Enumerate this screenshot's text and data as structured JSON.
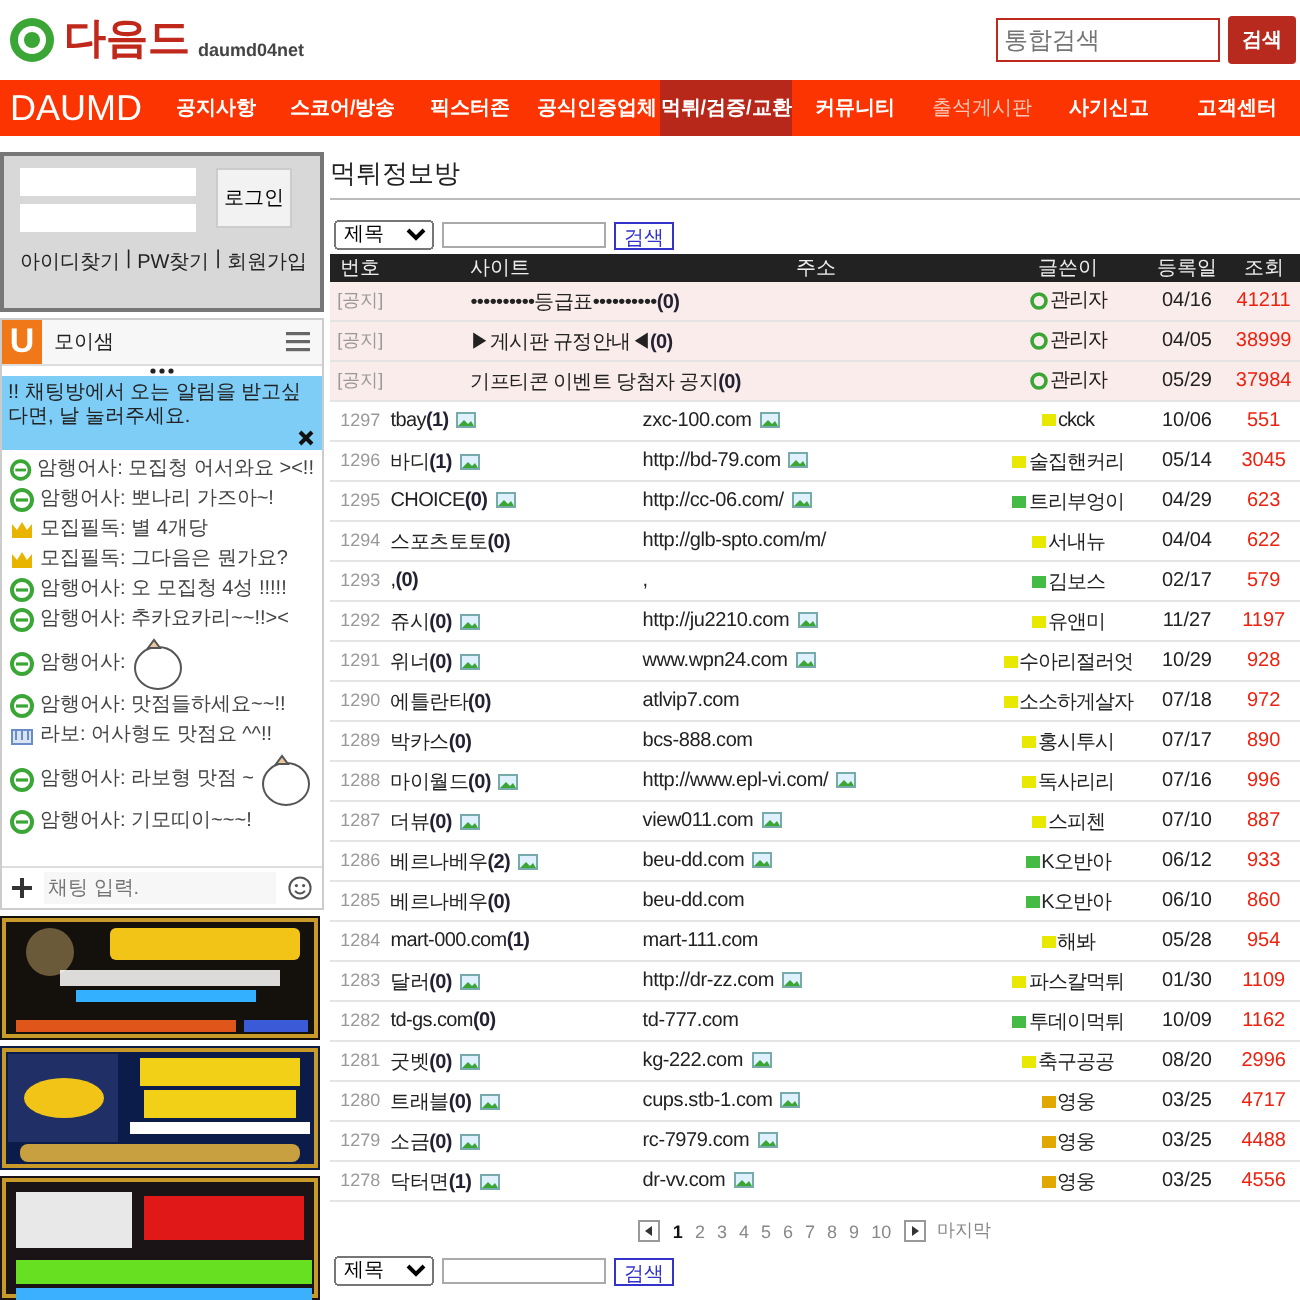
{
  "header": {
    "logo_text": "다음드",
    "logo_sub": "daumd04net",
    "search": {
      "placeholder": "통합검색",
      "button": "검색"
    }
  },
  "nav": {
    "brand": "DAUMD",
    "items": [
      {
        "label": "공지사항",
        "selected": false,
        "muted": false
      },
      {
        "label": "스코어/방송",
        "selected": false,
        "muted": false
      },
      {
        "label": "픽스터존",
        "selected": false,
        "muted": false
      },
      {
        "label": "공식인증업체",
        "selected": false,
        "muted": false
      },
      {
        "label": "먹튀/검증/교환",
        "selected": true,
        "muted": false
      },
      {
        "label": "커뮤니티",
        "selected": false,
        "muted": false
      },
      {
        "label": "출석게시판",
        "selected": false,
        "muted": true
      },
      {
        "label": "사기신고",
        "selected": false,
        "muted": false
      },
      {
        "label": "고객센터",
        "selected": false,
        "muted": false
      }
    ]
  },
  "login": {
    "button": "로그인",
    "links": [
      "아이디찾기",
      "PW찾기",
      "회원가입"
    ],
    "separator": "|"
  },
  "chat": {
    "logo": "U",
    "room": "모이샘",
    "notice": "!! 채팅방에서 오는 알림을 받고싶다면, 날 눌러주세요.",
    "input_placeholder": "채팅 입력.",
    "messages": [
      {
        "kind": "member",
        "text": "암행어사: 모집청 어서와요 ><!!",
        "sticker": false
      },
      {
        "kind": "member",
        "text": "암행어사: 뽀나리 가즈아~!",
        "sticker": false
      },
      {
        "kind": "crown",
        "text": "모집필독: 별 4개당",
        "sticker": false
      },
      {
        "kind": "crown",
        "text": "모집필독: 그다음은 뭔가요?",
        "sticker": false
      },
      {
        "kind": "member",
        "text": "암행어사: 오 모집청 4성 !!!!!",
        "sticker": false
      },
      {
        "kind": "member",
        "text": "암행어사: 추카요카리~~!!><",
        "sticker": false
      },
      {
        "kind": "member",
        "text": "암행어사:",
        "sticker": true
      },
      {
        "kind": "member",
        "text": "암행어사: 맛점들하세요~~!!",
        "sticker": false
      },
      {
        "kind": "guest",
        "text": "라보: 어사형도 맛점요 ^^!!",
        "sticker": false
      },
      {
        "kind": "member",
        "text": "암행어사: 라보형 맛점 ~",
        "sticker": true
      },
      {
        "kind": "member",
        "text": "암행어사: 기모띠이~~~!",
        "sticker": false
      }
    ]
  },
  "board": {
    "title": "먹튀정보방",
    "search": {
      "field": "제목",
      "button": "검색"
    },
    "columns": [
      "번호",
      "사이트",
      "주소",
      "글쓴이",
      "등록일",
      "조회"
    ],
    "notices": [
      {
        "label": "[공지]",
        "title": "••••••••••등급표••••••••••**(0)**",
        "writer": "관리자",
        "date": "04/16",
        "views": "41211"
      },
      {
        "label": "[공지]",
        "title": "▶게시판 규정안내◀**(0)**",
        "writer": "관리자",
        "date": "04/05",
        "views": "38999"
      },
      {
        "label": "[공지]",
        "title": "기프티콘 이벤트 당첨자 공지**(0)**",
        "writer": "관리자",
        "date": "05/29",
        "views": "37984"
      }
    ],
    "rows": [
      {
        "number": "1297",
        "site": "tbay**(1)**",
        "site_image": true,
        "address": "zxc-100.com",
        "address_image": true,
        "writer": "ckck",
        "color": "#e8e800",
        "date": "10/06",
        "views": "551"
      },
      {
        "number": "1296",
        "site": "바디**(1)**",
        "site_image": true,
        "address": "http://bd-79.com",
        "address_image": true,
        "writer": "술집핸커리",
        "color": "#e8e800",
        "date": "05/14",
        "views": "3045"
      },
      {
        "number": "1295",
        "site": "CHOICE**(0)**",
        "site_image": true,
        "address": "http://cc-06.com/",
        "address_image": true,
        "writer": "트리부엉이",
        "color": "#44bb44",
        "date": "04/29",
        "views": "623"
      },
      {
        "number": "1294",
        "site": "스포츠토토**(0)**",
        "site_image": false,
        "address": "http://glb-spto.com/m/",
        "address_image": false,
        "writer": "서내뉴",
        "color": "#e8e800",
        "date": "04/04",
        "views": "622"
      },
      {
        "number": "1293",
        "site": ",**(0)**",
        "site_image": false,
        "address": ",",
        "address_image": false,
        "writer": "김보스",
        "color": "#44bb44",
        "date": "02/17",
        "views": "579"
      },
      {
        "number": "1292",
        "site": "쥬시**(0)**",
        "site_image": true,
        "address": "http://ju2210.com",
        "address_image": true,
        "writer": "유앤미",
        "color": "#e8e800",
        "date": "11/27",
        "views": "1197"
      },
      {
        "number": "1291",
        "site": "위너**(0)**",
        "site_image": true,
        "address": "www.wpn24.com",
        "address_image": true,
        "writer": "수아리절러엇",
        "color": "#e8e800",
        "date": "10/29",
        "views": "928"
      },
      {
        "number": "1290",
        "site": "에틀란타**(0)**",
        "site_image": false,
        "address": "atlvip7.com",
        "address_image": false,
        "writer": "소소하게살자",
        "color": "#e8e800",
        "date": "07/18",
        "views": "972"
      },
      {
        "number": "1289",
        "site": "박카스**(0)**",
        "site_image": false,
        "address": "bcs-888.com",
        "address_image": false,
        "writer": "홍시투시",
        "color": "#e8e800",
        "date": "07/17",
        "views": "890"
      },
      {
        "number": "1288",
        "site": "마이월드**(0)**",
        "site_image": true,
        "address": "http://www.epl-vi.com/",
        "address_image": true,
        "writer": "독사리리",
        "color": "#e8e800",
        "date": "07/16",
        "views": "996"
      },
      {
        "number": "1287",
        "site": "더뷰**(0)**",
        "site_image": true,
        "address": "view011.com",
        "address_image": true,
        "writer": "스피첸",
        "color": "#e8e800",
        "date": "07/10",
        "views": "887"
      },
      {
        "number": "1286",
        "site": "베르나베우**(2)**",
        "site_image": true,
        "address": "beu-dd.com",
        "address_image": true,
        "writer": "K오반아",
        "color": "#44bb44",
        "date": "06/12",
        "views": "933"
      },
      {
        "number": "1285",
        "site": "베르나베우**(0)**",
        "site_image": false,
        "address": "beu-dd.com",
        "address_image": false,
        "writer": "K오반아",
        "color": "#44bb44",
        "date": "06/10",
        "views": "860"
      },
      {
        "number": "1284",
        "site": "mart-000.com**(1)**",
        "site_image": false,
        "address": "mart-111.com",
        "address_image": false,
        "writer": "해봐",
        "color": "#e8e800",
        "date": "05/28",
        "views": "954"
      },
      {
        "number": "1283",
        "site": "달러**(0)**",
        "site_image": true,
        "address": "http://dr-zz.com",
        "address_image": true,
        "writer": "파스칼먹튀",
        "color": "#e8e800",
        "date": "01/30",
        "views": "1109"
      },
      {
        "number": "1282",
        "site": "td-gs.com**(0)**",
        "site_image": false,
        "address": "td-777.com",
        "address_image": false,
        "writer": "투데이먹튀",
        "color": "#44bb44",
        "date": "10/09",
        "views": "1162"
      },
      {
        "number": "1281",
        "site": "굿벳**(0)**",
        "site_image": true,
        "address": "kg-222.com",
        "address_image": true,
        "writer": "축구공공",
        "color": "#e8e800",
        "date": "08/20",
        "views": "2996"
      },
      {
        "number": "1280",
        "site": "트래블**(0)**",
        "site_image": true,
        "address": "cups.stb-1.com",
        "address_image": true,
        "writer": "영웅",
        "color": "#e0a800",
        "date": "03/25",
        "views": "4717"
      },
      {
        "number": "1279",
        "site": "소금**(0)**",
        "site_image": true,
        "address": "rc-7979.com",
        "address_image": true,
        "writer": "영웅",
        "color": "#e0a800",
        "date": "03/25",
        "views": "4488"
      },
      {
        "number": "1278",
        "site": "닥터면**(1)**",
        "site_image": true,
        "address": "dr-vv.com",
        "address_image": true,
        "writer": "영웅",
        "color": "#e0a800",
        "date": "03/25",
        "views": "4556"
      }
    ],
    "pagination": {
      "pages": [
        {
          "label": "1",
          "selected": true
        },
        {
          "label": "2",
          "selected": false
        },
        {
          "label": "3",
          "selected": false
        },
        {
          "label": "4",
          "selected": false
        },
        {
          "label": "5",
          "selected": false
        },
        {
          "label": "6",
          "selected": false
        },
        {
          "label": "7",
          "selected": false
        },
        {
          "label": "8",
          "selected": false
        },
        {
          "label": "9",
          "selected": false
        },
        {
          "label": "10",
          "selected": false
        }
      ],
      "last": "마지막"
    },
    "bottom_search": {
      "field": "제목",
      "button": "검색"
    }
  }
}
